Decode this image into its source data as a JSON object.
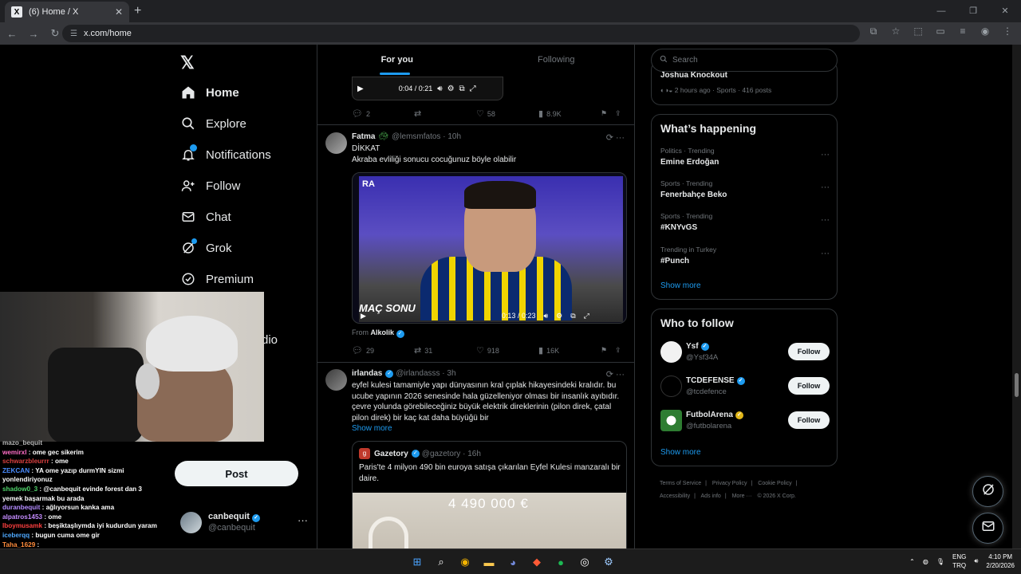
{
  "browser": {
    "tab_title": "(6) Home / X",
    "tab_close": "✕",
    "new_tab": "+",
    "url": "x.com/home",
    "win_min": "—",
    "win_max": "❐",
    "win_close": "✕"
  },
  "nav": {
    "logo": "𝕏",
    "items": [
      {
        "label": "Home",
        "icon": "home-icon"
      },
      {
        "label": "Explore",
        "icon": "search-icon"
      },
      {
        "label": "Notifications",
        "icon": "bell-icon"
      },
      {
        "label": "Follow",
        "icon": "person-add-icon"
      },
      {
        "label": "Chat",
        "icon": "mail-icon"
      },
      {
        "label": "Grok",
        "icon": "grok-icon"
      },
      {
        "label": "Premium",
        "icon": "premium-icon"
      }
    ],
    "partial_item": "dio",
    "post_button": "Post",
    "account_name": "canbequit",
    "account_handle": "@canbequit",
    "account_more": "···"
  },
  "chat": [
    {
      "user": "mazo_bequit",
      "msg": "",
      "color": "#b5b5b5"
    },
    {
      "user": "wemirxl",
      "msg": " : ome gec sikerim",
      "color": "#ff6ec7"
    },
    {
      "user": "schwarzbleurrr",
      "msg": " : ome",
      "color": "#d94040"
    },
    {
      "user": "ZEKCAN",
      "msg": " : YA ome yazıp durmYIN sizmi",
      "color": "#4a8cff"
    },
    {
      "user": "",
      "msg": "yonlendiriyonuz",
      "color": "#ffffff"
    },
    {
      "user": "shadow0_3",
      "msg": " : @canbequit evinde forest dan 3",
      "color": "#4fd16a"
    },
    {
      "user": "",
      "msg": "yemek başarmak bu arada",
      "color": "#ffffff"
    },
    {
      "user": "duranbequit",
      "msg": " : ağlıyorsun kanka ama",
      "color": "#b48cff"
    },
    {
      "user": "alpatros1453",
      "msg": " : ome",
      "color": "#c58cff"
    },
    {
      "user": "lboymusamk",
      "msg": " : beşiktaşlıymda iyi kudurdun yaram",
      "color": "#ff4040"
    },
    {
      "user": "iceberqq",
      "msg": " : bugun cuma ome gir",
      "color": "#4fa9ff"
    },
    {
      "user": "Taha_1629",
      "msg": " : ",
      "color": "#ff8c3c"
    },
    {
      "user": "talhabequit",
      "msg": " : ome",
      "color": "#e0e0e0"
    }
  ],
  "feed": {
    "tab_for_you": "For you",
    "tab_following": "Following",
    "post1": {
      "video_time": "0:04 / 0:21",
      "replies": "2",
      "reposts": "",
      "likes": "58",
      "views": "8.9K"
    },
    "post2": {
      "name": "Fatma",
      "handle": "@lemsmfatos · 10h",
      "line1": "DİKKAT",
      "line2": "Akraba evliliği sonucu cocuğunuz böyle olabilir",
      "video_logo": "RA",
      "video_label": "MAÇ SONU",
      "video_time": "0:13 / 0:23",
      "from_label": "From",
      "from_name": "Alkolik",
      "replies": "29",
      "reposts": "31",
      "likes": "918",
      "views": "16K"
    },
    "post3": {
      "name": "irlandas",
      "handle": "@irlandasss · 3h",
      "text": "eyfel kulesi tamamiyle yapı dünyasının kral çıplak hikayesindeki kralıdır. bu ucube yapının 2026 senesinde hala güzelleniyor olması bir insanlık ayıbıdır. çevre yolunda görebileceğiniz büyük elektrik direklerinin (pilon direk, çatal pilon direk) bir kaç kat daha büyüğü bir",
      "show_more": "Show more",
      "quote_name": "Gazetory",
      "quote_handle": "@gazetory · 16h",
      "quote_text": "Paris'te 4 milyon 490 bin euroya satışa çıkarılan Eyfel Kulesi manzaralı bir daire.",
      "quote_price": "4 490 000 €"
    }
  },
  "right": {
    "search_placeholder": "Search",
    "live_title": "Joshua Knockout",
    "live_meta": "2 hours ago · Sports · 416 posts",
    "whats_happening": "What’s happening",
    "trends": [
      {
        "category": "Politics · Trending",
        "name": "Emine Erdoğan"
      },
      {
        "category": "Sports · Trending",
        "name": "Fenerbahçe Beko"
      },
      {
        "category": "Sports · Trending",
        "name": "#KNYvGS"
      },
      {
        "category": "Trending in Turkey",
        "name": "#Punch"
      }
    ],
    "show_more": "Show more",
    "who_to_follow": "Who to follow",
    "follow_suggestions": [
      {
        "name": "Ysf",
        "handle": "@Ysf34A",
        "button": "Follow",
        "badge": "blue"
      },
      {
        "name": "TCDEFENSE",
        "handle": "@tcdefence",
        "button": "Follow",
        "badge": "blue"
      },
      {
        "name": "FutbolArena",
        "handle": "@futbolarena",
        "button": "Follow",
        "badge": "gold"
      }
    ],
    "show_more_2": "Show more",
    "footer": [
      "Terms of Service",
      "|",
      "Privacy Policy",
      "|",
      "Cookie Policy",
      "|",
      "Accessibility",
      "|",
      "Ads info",
      "|",
      "More ···",
      "© 2026 X Corp."
    ]
  },
  "taskbar": {
    "lang1": "ENG",
    "lang2": "TRQ",
    "time": "4:10 PM",
    "date": "2/20/2026"
  },
  "colors": {
    "accent": "#1d9bf0",
    "border": "#2f3336",
    "muted": "#71767b"
  }
}
